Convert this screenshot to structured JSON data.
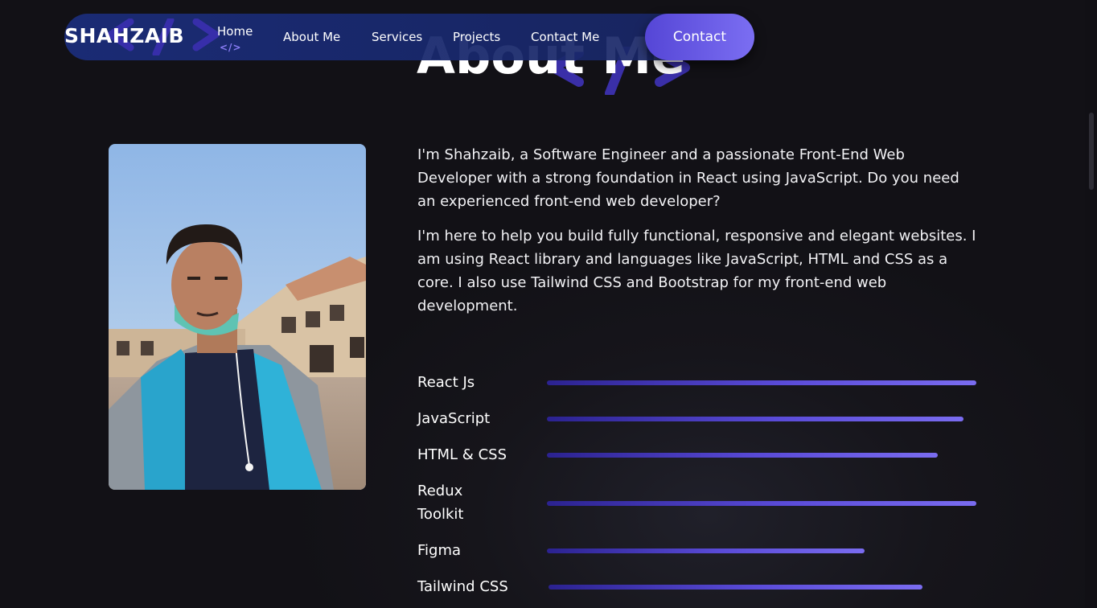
{
  "nav": {
    "brand": "SHAHZAIB",
    "items": [
      {
        "label": "Home",
        "active": true
      },
      {
        "label": "About Me",
        "active": false
      },
      {
        "label": "Services",
        "active": false
      },
      {
        "label": "Projects",
        "active": false
      },
      {
        "label": "Contact Me",
        "active": false
      }
    ],
    "active_mark": "</>",
    "contact_button": "Contact"
  },
  "section": {
    "title": "About Me"
  },
  "about": {
    "paragraph_1": "I'm Shahzaib, a Software Engineer and a passionate Front-End Web Developer with a strong foundation in React using JavaScript. Do you need an experienced front-end web developer?",
    "paragraph_2": "I'm here to help you build fully functional, responsive and elegant websites. I am using React library and languages like JavaScript, HTML and CSS as a core. I also use Tailwind CSS and Bootstrap for my front-end web development."
  },
  "skills": [
    {
      "name": "React Js",
      "level": 100
    },
    {
      "name": "JavaScript",
      "level": 97
    },
    {
      "name": "HTML & CSS",
      "level": 91
    },
    {
      "name": "Redux Toolkit",
      "level": 100
    },
    {
      "name": "Figma",
      "level": 74
    },
    {
      "name": "Tailwind CSS",
      "level": 87
    }
  ],
  "colors": {
    "background": "#131217",
    "nav_bg": "#1b2c78",
    "accent": "#7b6ef2",
    "accent_dark": "#2b2290"
  },
  "icons": {
    "code_brackets": "code-brackets-icon"
  }
}
